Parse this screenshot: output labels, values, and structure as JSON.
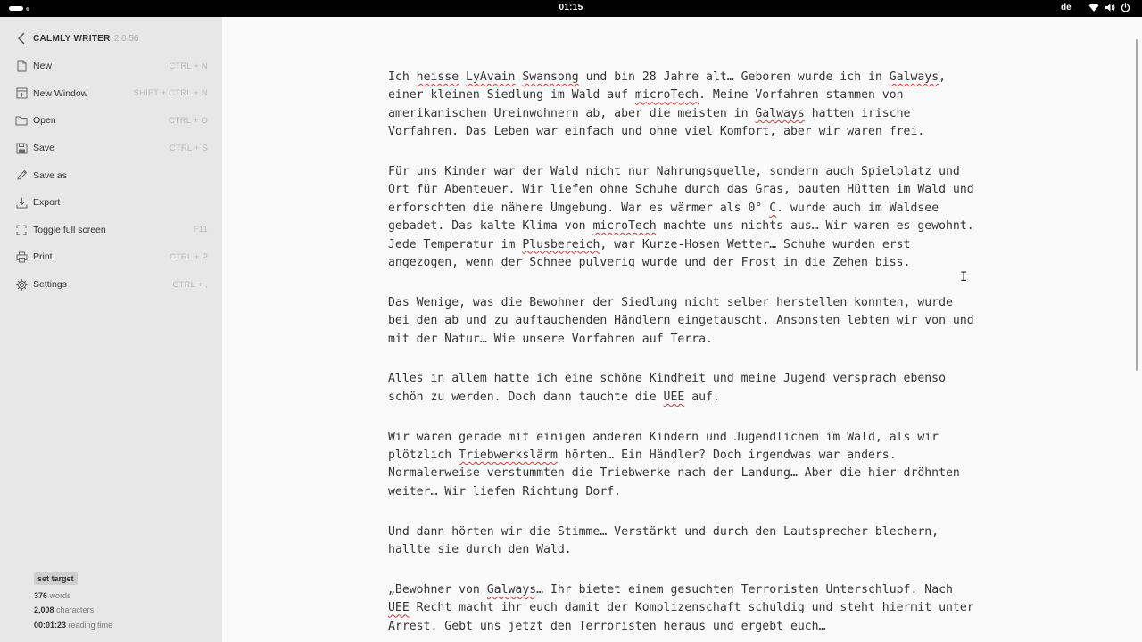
{
  "system_bar": {
    "clock": "01:15",
    "language": "de",
    "icons": [
      "activities-icon",
      "wifi-icon",
      "volume-icon",
      "power-icon"
    ]
  },
  "app": {
    "name": "CALMLY WRITER",
    "version": "2.0.56"
  },
  "menu": {
    "items": [
      {
        "label": "New",
        "shortcut": "CTRL + N",
        "icon": "new-file-icon"
      },
      {
        "label": "New Window",
        "shortcut": "SHIFT + CTRL + N",
        "icon": "new-window-icon"
      },
      {
        "label": "Open",
        "shortcut": "CTRL + O",
        "icon": "folder-icon"
      },
      {
        "label": "Save",
        "shortcut": "CTRL + S",
        "icon": "save-icon"
      },
      {
        "label": "Save as",
        "shortcut": "",
        "icon": "pencil-icon"
      },
      {
        "label": "Export",
        "shortcut": "",
        "icon": "download-icon"
      },
      {
        "label": "Toggle full screen",
        "shortcut": "F11",
        "icon": "fullscreen-icon"
      },
      {
        "label": "Print",
        "shortcut": "CTRL + P",
        "icon": "printer-icon"
      },
      {
        "label": "Settings",
        "shortcut": "CTRL + ,",
        "icon": "gear-icon"
      }
    ]
  },
  "stats": {
    "set_target": "set target",
    "words_value": "376",
    "words_label": "words",
    "characters_value": "2,008",
    "characters_label": "characters",
    "reading_value": "00:01:23",
    "reading_label": "reading time"
  },
  "document": {
    "paragraphs": [
      [
        {
          "t": "Ich "
        },
        {
          "t": "heisse",
          "spell": true
        },
        {
          "t": " "
        },
        {
          "t": "LyAvain",
          "spell": true
        },
        {
          "t": " "
        },
        {
          "t": "Swansong",
          "spell": true
        },
        {
          "t": " und bin 28 Jahre alt… Geboren wurde ich in "
        },
        {
          "t": "Galways",
          "spell": true
        },
        {
          "t": ", einer kleinen Siedlung im Wald auf "
        },
        {
          "t": "microTech",
          "spell": true
        },
        {
          "t": ". Meine Vorfahren stammen von amerikanischen Ureinwohnern ab, aber die meisten in "
        },
        {
          "t": "Galways",
          "spell": true
        },
        {
          "t": " hatten irische Vorfahren. Das Leben war einfach und ohne viel Komfort, aber wir waren frei."
        }
      ],
      [
        {
          "t": "Für uns Kinder war der Wald nicht nur Nahrungsquelle, sondern auch Spielplatz und Ort für Abenteuer. Wir liefen ohne Schuhe durch das Gras, bauten Hütten im Wald und erforschten die nähere Umgebung. War es wärmer als 0° "
        },
        {
          "t": "C",
          "spell": true
        },
        {
          "t": ". wurde auch im Waldsee gebadet. Das kalte Klima von "
        },
        {
          "t": "microTech",
          "spell": true
        },
        {
          "t": " machte uns nichts aus… Wir waren es gewohnt. Jede Temperatur im "
        },
        {
          "t": "Plusbereich",
          "spell": true
        },
        {
          "t": ", war Kurze-Hosen Wetter… Schuhe wurden erst angezogen, wenn der Schnee pulverig wurde und der Frost in die Zehen biss."
        }
      ],
      [
        {
          "t": "Das Wenige, was die Bewohner der Siedlung nicht selber herstellen konnten, wurde bei den ab und zu auftauchenden Händlern eingetauscht. Ansonsten lebten wir von und mit der Natur… Wie unsere Vorfahren auf Terra."
        }
      ],
      [
        {
          "t": "Alles in allem hatte ich eine schöne Kindheit und meine Jugend versprach ebenso schön zu werden. Doch dann tauchte die "
        },
        {
          "t": "UEE",
          "spell": true
        },
        {
          "t": " auf."
        }
      ],
      [
        {
          "t": "Wir waren gerade mit einigen anderen Kindern und Jugendlichem im Wald, als wir plötzlich "
        },
        {
          "t": "Triebwerkslärm",
          "spell": true
        },
        {
          "t": " hörten… Ein Händler? Doch irgendwas war anders. Normalerweise verstummten die Triebwerke nach der Landung… Aber die hier dröhnten weiter… Wir liefen Richtung Dorf."
        }
      ],
      [
        {
          "t": "Und dann hörten wir die Stimme… Verstärkt und durch den Lautsprecher blechern, hallte sie durch den Wald."
        }
      ],
      [
        {
          "t": "„Bewohner von "
        },
        {
          "t": "Galways",
          "spell": true
        },
        {
          "t": "… Ihr bietet einem gesuchten Terroristen Unterschlupf. Nach "
        },
        {
          "t": "UEE",
          "spell": true
        },
        {
          "t": " Recht macht ihr euch damit der Komplizenschaft schuldig und steht hiermit unter Arrest. Gebt uns jetzt den Terroristen heraus und ergebt euch…"
        }
      ]
    ]
  },
  "colors": {
    "sidebar_bg": "#e7e7e7",
    "editor_bg": "#fafafa",
    "spell_error": "#d23a3a"
  }
}
